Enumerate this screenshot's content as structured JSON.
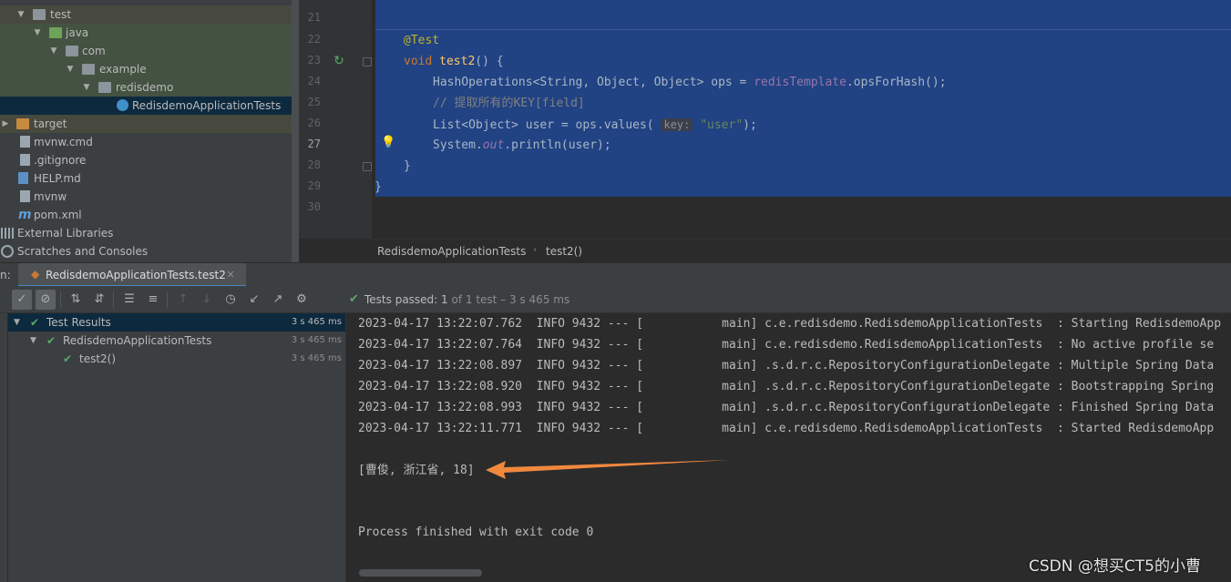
{
  "project_tree": {
    "items": [
      {
        "label": "test",
        "icon": "folder-icon"
      },
      {
        "label": "java",
        "icon": "folder-green-icon"
      },
      {
        "label": "com",
        "icon": "package-icon"
      },
      {
        "label": "example",
        "icon": "package-icon"
      },
      {
        "label": "redisdemo",
        "icon": "package-icon"
      },
      {
        "label": "RedisdemoApplicationTests",
        "icon": "test-class-icon"
      },
      {
        "label": "target",
        "icon": "folder-orange-icon"
      },
      {
        "label": "mvnw.cmd",
        "icon": "file-icon"
      },
      {
        "label": ".gitignore",
        "icon": "file-icon"
      },
      {
        "label": "HELP.md",
        "icon": "markdown-file-icon"
      },
      {
        "label": "mvnw",
        "icon": "file-icon"
      },
      {
        "label": "pom.xml",
        "icon": "maven-icon"
      },
      {
        "label": "External Libraries",
        "icon": "library-icon"
      },
      {
        "label": "Scratches and Consoles",
        "icon": "scratches-icon"
      }
    ]
  },
  "editor": {
    "line_numbers": [
      "21",
      "22",
      "23",
      "24",
      "25",
      "26",
      "27",
      "28",
      "29",
      "30"
    ],
    "code": {
      "l22_annotation": "@Test",
      "l23_kw": "void",
      "l23_name": "test2",
      "l23_rest": "() {",
      "l24_type": "HashOperations<String, Object, Object> ops = ",
      "l24_field": "redisTemplate",
      "l24_call": ".opsForHash();",
      "l25_comment": "// 提取所有的KEY[field]",
      "l26_start": "List<Object> user = ops.values(",
      "l26_hint": "key:",
      "l26_string": "\"user\"",
      "l26_end": ");",
      "l27_start": "System.",
      "l27_field": "out",
      "l27_end": ".println(user);",
      "l28": "}",
      "l29": "}"
    },
    "breadcrumb": [
      "RedisdemoApplicationTests",
      "test2()"
    ]
  },
  "run_window": {
    "label": "n:",
    "tab_label": "RedisdemoApplicationTests.test2",
    "close_glyph": "×",
    "status": {
      "text": "Tests passed:",
      "count": "1",
      "of_total": "of 1 test",
      "time": "– 3 s 465 ms"
    },
    "results": [
      {
        "label": "Test Results",
        "time": "3 s 465 ms"
      },
      {
        "label": "RedisdemoApplicationTests",
        "time": "3 s 465 ms"
      },
      {
        "label": "test2()",
        "time": "3 s 465 ms"
      }
    ],
    "console": {
      "log_lines": [
        "2023-04-17 13:22:07.762  INFO 9432 --- [           main] c.e.redisdemo.RedisdemoApplicationTests  : Starting RedisdemoApp",
        "2023-04-17 13:22:07.764  INFO 9432 --- [           main] c.e.redisdemo.RedisdemoApplicationTests  : No active profile se",
        "2023-04-17 13:22:08.897  INFO 9432 --- [           main] .s.d.r.c.RepositoryConfigurationDelegate : Multiple Spring Data",
        "2023-04-17 13:22:08.920  INFO 9432 --- [           main] .s.d.r.c.RepositoryConfigurationDelegate : Bootstrapping Spring",
        "2023-04-17 13:22:08.993  INFO 9432 --- [           main] .s.d.r.c.RepositoryConfigurationDelegate : Finished Spring Data",
        "2023-04-17 13:22:11.771  INFO 9432 --- [           main] c.e.redisdemo.RedisdemoApplicationTests  : Started RedisdemoApp"
      ],
      "output": "[曹俊, 浙江省, 18]",
      "exit": "Process finished with exit code 0"
    }
  },
  "colors": {
    "arrow_annotation": "#f0883e",
    "pass_green": "#59a869",
    "selection": "#214283"
  },
  "watermark": "CSDN @想买CT5的小曹"
}
